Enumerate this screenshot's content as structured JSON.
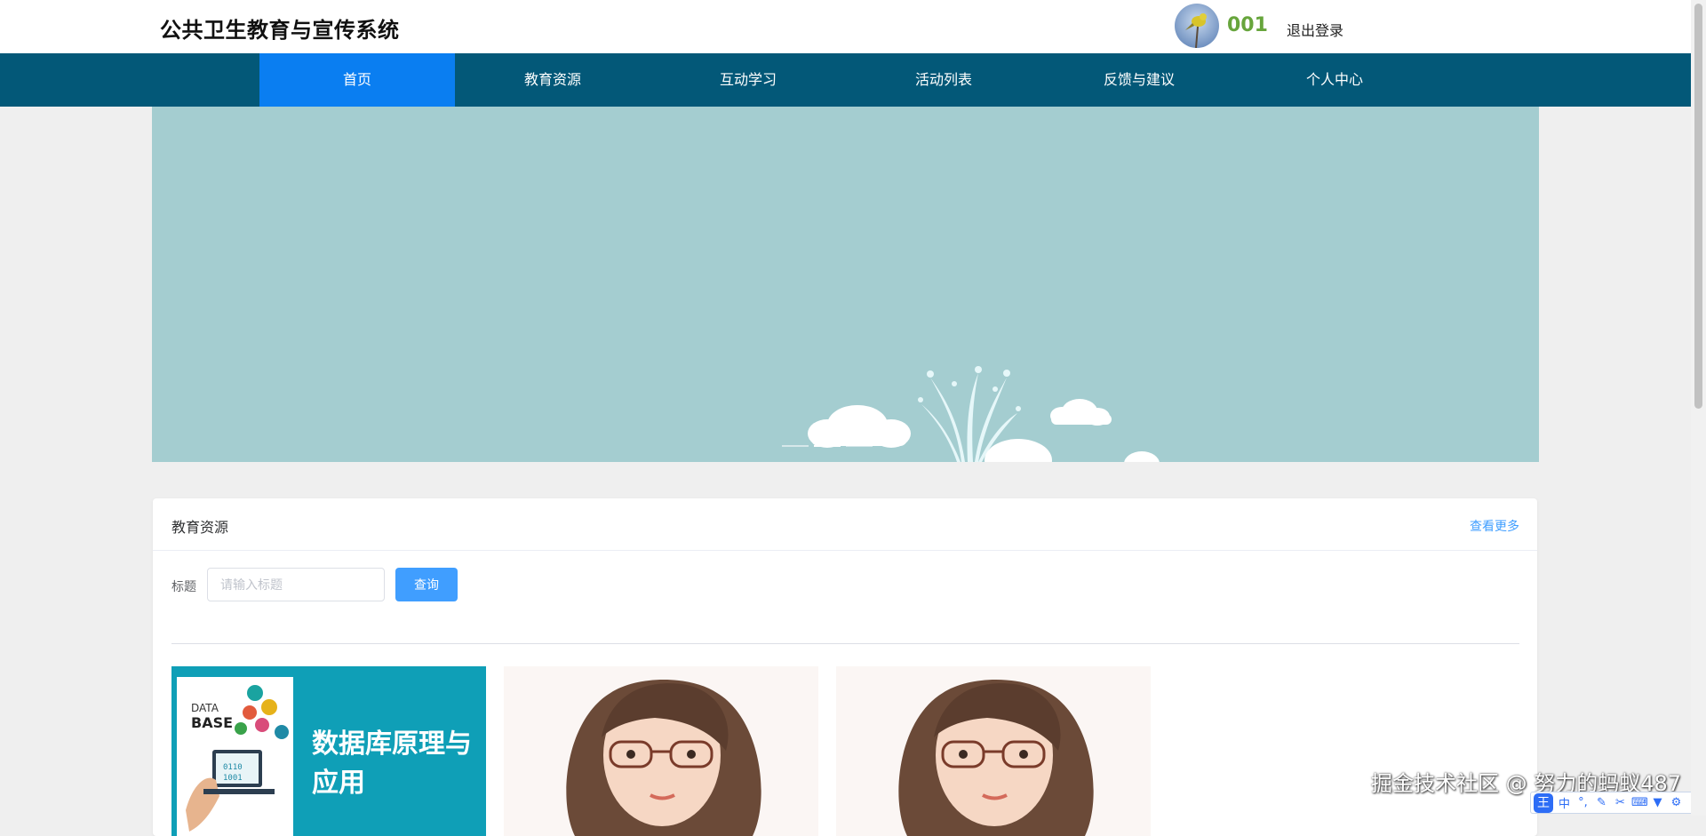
{
  "header": {
    "site_title": "公共卫生教育与宣传系统",
    "username": "001",
    "logout_label": "退出登录"
  },
  "nav": {
    "items": [
      {
        "label": "首页",
        "active": true
      },
      {
        "label": "教育资源",
        "active": false
      },
      {
        "label": "互动学习",
        "active": false
      },
      {
        "label": "活动列表",
        "active": false
      },
      {
        "label": "反馈与建议",
        "active": false
      },
      {
        "label": "个人中心",
        "active": false
      }
    ]
  },
  "banner": {
    "slides": 3,
    "active_slide": 2
  },
  "section": {
    "title": "教育资源",
    "more_label": "查看更多",
    "filter_label": "标题",
    "search_placeholder": "请输入标题",
    "search_value": "",
    "query_label": "查询"
  },
  "cards": [
    {
      "title": "数据库原理与应用",
      "tag_data": "DATA",
      "tag_base": "BASE"
    },
    {
      "title": ""
    },
    {
      "title": ""
    }
  ],
  "watermark": "掘金技术社区 @ 努力的蚂蚁487",
  "ime": {
    "logo": "王",
    "lang": "中",
    "icons": [
      "punctuation-icon",
      "pen-icon",
      "scissors-icon",
      "keyboard-icon",
      "shirt-icon",
      "settings-icon"
    ]
  },
  "colors": {
    "nav_bg": "#035878",
    "nav_active": "#0a7ef1",
    "banner_bg": "#a4cdd0",
    "primary": "#409eff",
    "username": "#67a53c"
  }
}
